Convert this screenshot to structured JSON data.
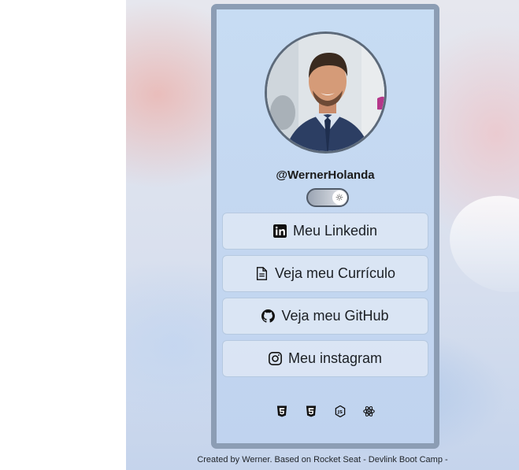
{
  "profile": {
    "username": "@WernerHolanda",
    "photo_alt": "Foto de perfil"
  },
  "theme_toggle": {
    "icon": "sun-icon",
    "state": "light"
  },
  "links": [
    {
      "label": "Meu Linkedin",
      "icon": "linkedin-icon"
    },
    {
      "label": "Veja meu Currículo",
      "icon": "document-icon"
    },
    {
      "label": "Veja meu GitHub",
      "icon": "github-icon"
    },
    {
      "label": "Meu instagram",
      "icon": "instagram-icon"
    }
  ],
  "tech_icons": [
    "html5-icon",
    "css3-icon",
    "nodejs-icon",
    "react-icon"
  ],
  "footer": {
    "text": "Created by Werner. Based on Rocket Seat - Devlink Boot Camp -"
  },
  "colors": {
    "card_border": "#8c9db4",
    "card_bg": "#c7dcf3",
    "button_bg": "#e2eaf5",
    "text": "#1b1f24"
  }
}
